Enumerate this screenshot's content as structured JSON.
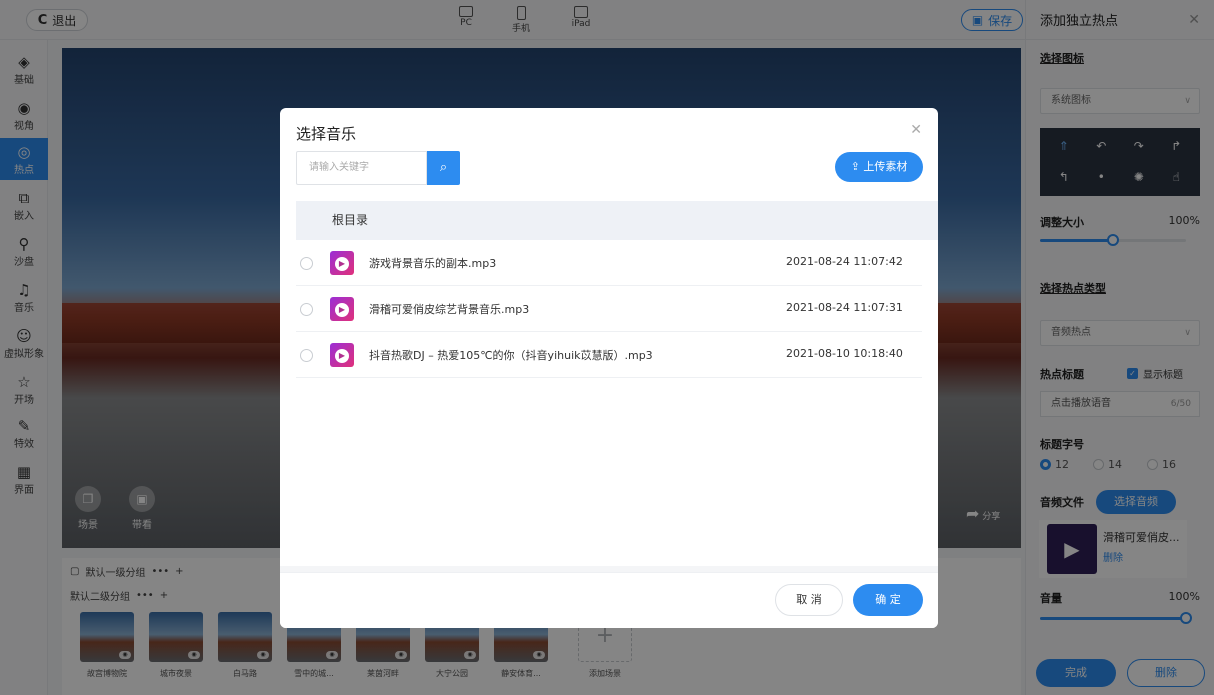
{
  "topbar": {
    "exit_label": "退出",
    "devices": [
      "PC",
      "手机",
      "iPad"
    ],
    "save_label": "保存"
  },
  "sidebar": {
    "items": [
      {
        "label": "基础",
        "icon": "layers-icon"
      },
      {
        "label": "视角",
        "icon": "eye-icon"
      },
      {
        "label": "热点",
        "icon": "hotspot-icon"
      },
      {
        "label": "嵌入",
        "icon": "embed-icon"
      },
      {
        "label": "沙盘",
        "icon": "map-pin-icon"
      },
      {
        "label": "音乐",
        "icon": "music-icon"
      },
      {
        "label": "虚拟形象",
        "icon": "avatar-icon"
      },
      {
        "label": "开场",
        "icon": "star-icon"
      },
      {
        "label": "特效",
        "icon": "effect-icon"
      },
      {
        "label": "界面",
        "icon": "grid-icon"
      }
    ],
    "active": "热点"
  },
  "preview": {
    "buttons": [
      "场景",
      "带看"
    ],
    "share_label": "分享"
  },
  "groups": {
    "level1": "默认一级分组",
    "level2": "默认二级分组",
    "more": "•••",
    "add": "+",
    "scenes": [
      "故宫博物院",
      "城市夜景",
      "白马路",
      "雪中的城...",
      "莱茵河畔",
      "大宁公园",
      "静安体育...",
      "添加场景"
    ]
  },
  "right_panel": {
    "title": "添加独立热点",
    "choose_icon": "选择图标",
    "icon_source": "系统图标",
    "size_label": "调整大小",
    "size_value": "100%",
    "size_fraction": 0.5,
    "hotspot_type_label": "选择热点类型",
    "hotspot_type": "音频热点",
    "hotspot_title_label": "热点标题",
    "show_title_label": "显示标题",
    "title_value": "点击播放语音",
    "title_count": "6/50",
    "font_size_label": "标题字号",
    "font_sizes": [
      "12",
      "14",
      "16"
    ],
    "font_size_selected": "12",
    "audio_file_label": "音频文件",
    "choose_audio_label": "选择音频",
    "audio_name": "滑稽可爱俏皮...",
    "audio_delete": "删除",
    "volume_label": "音量",
    "volume_value": "100%",
    "volume_fraction": 1.0,
    "done_label": "完成",
    "delete_label": "删除"
  },
  "modal": {
    "title": "选择音乐",
    "search_placeholder": "请输入关键字",
    "upload_label": "上传素材",
    "root_label": "根目录",
    "files": [
      {
        "name": "游戏背景音乐的副本.mp3",
        "date": "2021-08-24 11:07:42"
      },
      {
        "name": "滑稽可爱俏皮综艺背景音乐.mp3",
        "date": "2021-08-24 11:07:31"
      },
      {
        "name": "抖音热歌DJ – 热爱105℃的你（抖音yihuik苡慧版）.mp3",
        "date": "2021-08-10 10:18:40"
      }
    ],
    "cancel_label": "取 消",
    "ok_label": "确 定"
  },
  "colors": {
    "accent": "#2d8cf0",
    "overlay": "rgba(0,0,0,0.48)"
  }
}
